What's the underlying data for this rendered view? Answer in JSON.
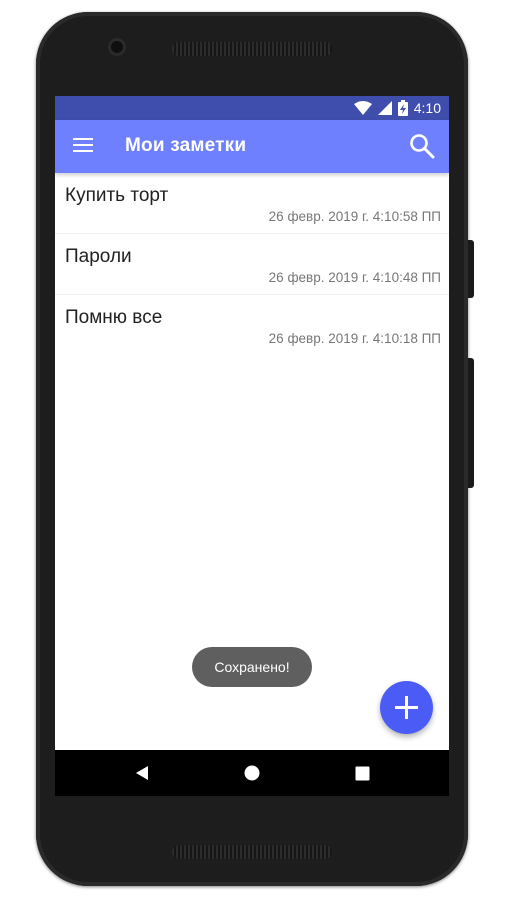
{
  "status_bar": {
    "time": "4:10",
    "icons": [
      "wifi-icon",
      "signal-icon",
      "battery-charging-icon"
    ],
    "color": "#3f4ead"
  },
  "app_bar": {
    "title": "Мои заметки",
    "color": "#6f80ff",
    "icons": [
      "menu-icon",
      "search-icon"
    ]
  },
  "notes": [
    {
      "title": "Купить торт",
      "date": "26 февр. 2019 г. 4:10:58 ПП"
    },
    {
      "title": "Пароли",
      "date": "26 февр. 2019 г. 4:10:48 ПП"
    },
    {
      "title": "Помню все",
      "date": "26 февр. 2019 г. 4:10:18 ПП"
    }
  ],
  "toast": {
    "text": "Сохранено!"
  },
  "fab": {
    "icon": "plus-icon",
    "color": "#4a5cf5"
  },
  "nav_bar": {
    "icons": [
      "back-icon",
      "home-icon",
      "recents-icon"
    ]
  }
}
